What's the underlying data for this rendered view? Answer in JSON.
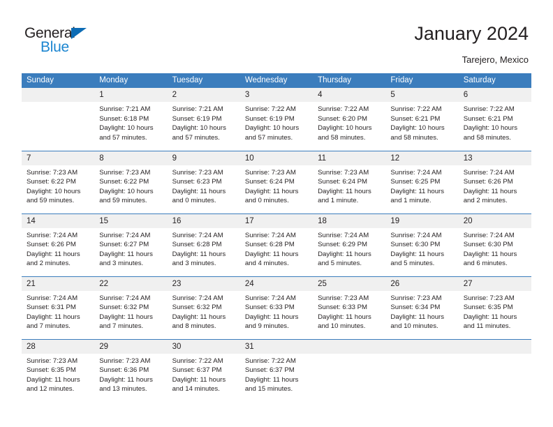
{
  "brand": {
    "name_dark": "General",
    "name_blue": "Blue",
    "accent_color": "#1b85d0",
    "header_color": "#3b7dbd"
  },
  "header": {
    "title": "January 2024",
    "subtitle": "Tarejero, Mexico"
  },
  "calendar": {
    "weekday_headers": [
      "Sunday",
      "Monday",
      "Tuesday",
      "Wednesday",
      "Thursday",
      "Friday",
      "Saturday"
    ],
    "weeks": [
      [
        {
          "day": "",
          "sunrise": "",
          "sunset": "",
          "daylight": "",
          "daylight2": ""
        },
        {
          "day": "1",
          "sunrise": "Sunrise: 7:21 AM",
          "sunset": "Sunset: 6:18 PM",
          "daylight": "Daylight: 10 hours",
          "daylight2": "and 57 minutes."
        },
        {
          "day": "2",
          "sunrise": "Sunrise: 7:21 AM",
          "sunset": "Sunset: 6:19 PM",
          "daylight": "Daylight: 10 hours",
          "daylight2": "and 57 minutes."
        },
        {
          "day": "3",
          "sunrise": "Sunrise: 7:22 AM",
          "sunset": "Sunset: 6:19 PM",
          "daylight": "Daylight: 10 hours",
          "daylight2": "and 57 minutes."
        },
        {
          "day": "4",
          "sunrise": "Sunrise: 7:22 AM",
          "sunset": "Sunset: 6:20 PM",
          "daylight": "Daylight: 10 hours",
          "daylight2": "and 58 minutes."
        },
        {
          "day": "5",
          "sunrise": "Sunrise: 7:22 AM",
          "sunset": "Sunset: 6:21 PM",
          "daylight": "Daylight: 10 hours",
          "daylight2": "and 58 minutes."
        },
        {
          "day": "6",
          "sunrise": "Sunrise: 7:22 AM",
          "sunset": "Sunset: 6:21 PM",
          "daylight": "Daylight: 10 hours",
          "daylight2": "and 58 minutes."
        }
      ],
      [
        {
          "day": "7",
          "sunrise": "Sunrise: 7:23 AM",
          "sunset": "Sunset: 6:22 PM",
          "daylight": "Daylight: 10 hours",
          "daylight2": "and 59 minutes."
        },
        {
          "day": "8",
          "sunrise": "Sunrise: 7:23 AM",
          "sunset": "Sunset: 6:22 PM",
          "daylight": "Daylight: 10 hours",
          "daylight2": "and 59 minutes."
        },
        {
          "day": "9",
          "sunrise": "Sunrise: 7:23 AM",
          "sunset": "Sunset: 6:23 PM",
          "daylight": "Daylight: 11 hours",
          "daylight2": "and 0 minutes."
        },
        {
          "day": "10",
          "sunrise": "Sunrise: 7:23 AM",
          "sunset": "Sunset: 6:24 PM",
          "daylight": "Daylight: 11 hours",
          "daylight2": "and 0 minutes."
        },
        {
          "day": "11",
          "sunrise": "Sunrise: 7:23 AM",
          "sunset": "Sunset: 6:24 PM",
          "daylight": "Daylight: 11 hours",
          "daylight2": "and 1 minute."
        },
        {
          "day": "12",
          "sunrise": "Sunrise: 7:24 AM",
          "sunset": "Sunset: 6:25 PM",
          "daylight": "Daylight: 11 hours",
          "daylight2": "and 1 minute."
        },
        {
          "day": "13",
          "sunrise": "Sunrise: 7:24 AM",
          "sunset": "Sunset: 6:26 PM",
          "daylight": "Daylight: 11 hours",
          "daylight2": "and 2 minutes."
        }
      ],
      [
        {
          "day": "14",
          "sunrise": "Sunrise: 7:24 AM",
          "sunset": "Sunset: 6:26 PM",
          "daylight": "Daylight: 11 hours",
          "daylight2": "and 2 minutes."
        },
        {
          "day": "15",
          "sunrise": "Sunrise: 7:24 AM",
          "sunset": "Sunset: 6:27 PM",
          "daylight": "Daylight: 11 hours",
          "daylight2": "and 3 minutes."
        },
        {
          "day": "16",
          "sunrise": "Sunrise: 7:24 AM",
          "sunset": "Sunset: 6:28 PM",
          "daylight": "Daylight: 11 hours",
          "daylight2": "and 3 minutes."
        },
        {
          "day": "17",
          "sunrise": "Sunrise: 7:24 AM",
          "sunset": "Sunset: 6:28 PM",
          "daylight": "Daylight: 11 hours",
          "daylight2": "and 4 minutes."
        },
        {
          "day": "18",
          "sunrise": "Sunrise: 7:24 AM",
          "sunset": "Sunset: 6:29 PM",
          "daylight": "Daylight: 11 hours",
          "daylight2": "and 5 minutes."
        },
        {
          "day": "19",
          "sunrise": "Sunrise: 7:24 AM",
          "sunset": "Sunset: 6:30 PM",
          "daylight": "Daylight: 11 hours",
          "daylight2": "and 5 minutes."
        },
        {
          "day": "20",
          "sunrise": "Sunrise: 7:24 AM",
          "sunset": "Sunset: 6:30 PM",
          "daylight": "Daylight: 11 hours",
          "daylight2": "and 6 minutes."
        }
      ],
      [
        {
          "day": "21",
          "sunrise": "Sunrise: 7:24 AM",
          "sunset": "Sunset: 6:31 PM",
          "daylight": "Daylight: 11 hours",
          "daylight2": "and 7 minutes."
        },
        {
          "day": "22",
          "sunrise": "Sunrise: 7:24 AM",
          "sunset": "Sunset: 6:32 PM",
          "daylight": "Daylight: 11 hours",
          "daylight2": "and 7 minutes."
        },
        {
          "day": "23",
          "sunrise": "Sunrise: 7:24 AM",
          "sunset": "Sunset: 6:32 PM",
          "daylight": "Daylight: 11 hours",
          "daylight2": "and 8 minutes."
        },
        {
          "day": "24",
          "sunrise": "Sunrise: 7:24 AM",
          "sunset": "Sunset: 6:33 PM",
          "daylight": "Daylight: 11 hours",
          "daylight2": "and 9 minutes."
        },
        {
          "day": "25",
          "sunrise": "Sunrise: 7:23 AM",
          "sunset": "Sunset: 6:33 PM",
          "daylight": "Daylight: 11 hours",
          "daylight2": "and 10 minutes."
        },
        {
          "day": "26",
          "sunrise": "Sunrise: 7:23 AM",
          "sunset": "Sunset: 6:34 PM",
          "daylight": "Daylight: 11 hours",
          "daylight2": "and 10 minutes."
        },
        {
          "day": "27",
          "sunrise": "Sunrise: 7:23 AM",
          "sunset": "Sunset: 6:35 PM",
          "daylight": "Daylight: 11 hours",
          "daylight2": "and 11 minutes."
        }
      ],
      [
        {
          "day": "28",
          "sunrise": "Sunrise: 7:23 AM",
          "sunset": "Sunset: 6:35 PM",
          "daylight": "Daylight: 11 hours",
          "daylight2": "and 12 minutes."
        },
        {
          "day": "29",
          "sunrise": "Sunrise: 7:23 AM",
          "sunset": "Sunset: 6:36 PM",
          "daylight": "Daylight: 11 hours",
          "daylight2": "and 13 minutes."
        },
        {
          "day": "30",
          "sunrise": "Sunrise: 7:22 AM",
          "sunset": "Sunset: 6:37 PM",
          "daylight": "Daylight: 11 hours",
          "daylight2": "and 14 minutes."
        },
        {
          "day": "31",
          "sunrise": "Sunrise: 7:22 AM",
          "sunset": "Sunset: 6:37 PM",
          "daylight": "Daylight: 11 hours",
          "daylight2": "and 15 minutes."
        },
        {
          "day": "",
          "sunrise": "",
          "sunset": "",
          "daylight": "",
          "daylight2": ""
        },
        {
          "day": "",
          "sunrise": "",
          "sunset": "",
          "daylight": "",
          "daylight2": ""
        },
        {
          "day": "",
          "sunrise": "",
          "sunset": "",
          "daylight": "",
          "daylight2": ""
        }
      ]
    ]
  }
}
